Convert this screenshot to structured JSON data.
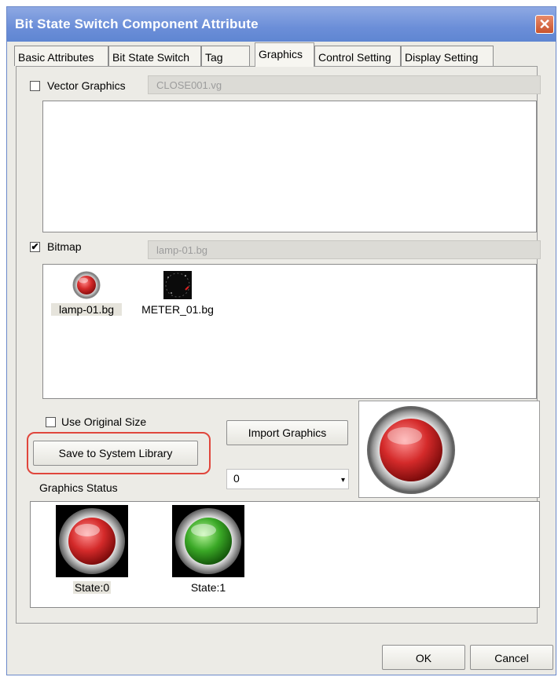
{
  "window": {
    "title": "Bit State Switch Component Attribute",
    "close_glyph": "✕"
  },
  "tabs": [
    {
      "label": "Basic Attributes",
      "active": false
    },
    {
      "label": "Bit State Switch",
      "active": false
    },
    {
      "label": "Tag",
      "active": false
    },
    {
      "label": "Graphics",
      "active": true
    },
    {
      "label": "Control Setting",
      "active": false
    },
    {
      "label": "Display Setting",
      "active": false
    }
  ],
  "vector_graphics": {
    "checkbox_label": "Vector Graphics",
    "checked": false,
    "file_name": "CLOSE001.vg"
  },
  "bitmap": {
    "checkbox_label": "Bitmap",
    "checked": true,
    "check_glyph": "✔",
    "file_name": "lamp-01.bg",
    "items": [
      {
        "label": "lamp-01.bg",
        "icon": "red-lamp-icon",
        "selected": true
      },
      {
        "label": "METER_01.bg",
        "icon": "meter-icon",
        "selected": false
      }
    ]
  },
  "use_original_size": {
    "label": "Use Original Size",
    "checked": false
  },
  "buttons": {
    "import_graphics": "Import Graphics",
    "save_to_library": "Save to System Library",
    "ok": "OK",
    "cancel": "Cancel"
  },
  "state_select": {
    "value": "0",
    "arrow": "▾"
  },
  "graphics_status": {
    "label": "Graphics Status",
    "states": [
      {
        "label": "State:0",
        "color": "red",
        "selected": true
      },
      {
        "label": "State:1",
        "color": "green",
        "selected": false
      }
    ]
  },
  "colors": {
    "titlebar": "#6b8ed8",
    "highlight": "#e0463c",
    "lamp_red": "#d42a2a",
    "lamp_green": "#3aa826"
  }
}
